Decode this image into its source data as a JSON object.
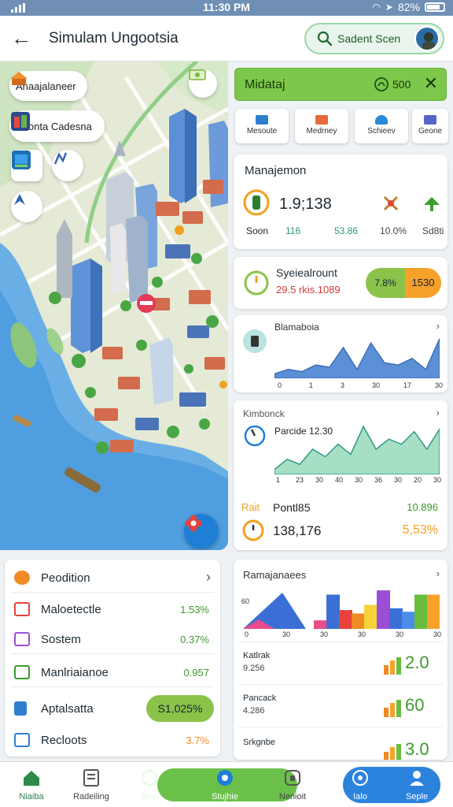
{
  "status": {
    "time": "11:30 PM",
    "battery": "82%"
  },
  "header": {
    "title": "Simulam Ungootsia",
    "search_text": "Sadent Scen"
  },
  "map": {
    "chip_1": "Anaajalaneer",
    "chip_2": "Sbonta Cadesna"
  },
  "panel": {
    "title": "Midataj",
    "coins": "500",
    "quick": [
      "Mesoute",
      "Medrney",
      "Schieev",
      "Geone"
    ]
  },
  "management": {
    "title": "Manajemon",
    "big_value": "1.9;138",
    "labels": [
      "Soon",
      "116",
      "53.86",
      "10.0%",
      "Sd8ti"
    ]
  },
  "scheduler": {
    "title": "Syeiealrount",
    "sub": "29.5 rkis.1089",
    "pill_left": "7.8%",
    "pill_right": "1530"
  },
  "chart1": {
    "title": "Blamaboia",
    "ticks": [
      "0",
      "1",
      "3",
      "30",
      "17",
      "30"
    ]
  },
  "chart2": {
    "title": "Kimbonck",
    "sub": "Parcide 12.30",
    "ticks": [
      "1",
      "23",
      "30",
      "40",
      "30",
      "36",
      "30",
      "20",
      "30"
    ],
    "foot_label": "Rait",
    "foot_name": "Pontl85",
    "foot_right": "10.896",
    "foot_value": "138,176",
    "foot_pct": "5,53%"
  },
  "left_list": {
    "rows": [
      {
        "label": "Peodition",
        "value": ""
      },
      {
        "label": "Maloetectle",
        "value": "1.53%"
      },
      {
        "label": "Sostem",
        "value": "0.37%"
      },
      {
        "label": "Manlriaianoe",
        "value": "0.957"
      },
      {
        "label": "Aptalsatta",
        "value": "S1,025%"
      },
      {
        "label": "Recloots",
        "value": "3.7%"
      }
    ]
  },
  "chart3": {
    "title": "Ramajanaees",
    "ylab": "60",
    "ticks": [
      "0",
      "30",
      "30",
      "30",
      "30",
      "30"
    ],
    "bars": [
      10,
      40,
      22,
      18,
      28,
      45,
      24,
      20,
      40,
      40
    ],
    "bar_colors": [
      "#e84c8b",
      "#3b6fd6",
      "#e8423a",
      "#f08a24",
      "#f6d23a",
      "#9b4fd6",
      "#3b6fd6",
      "#4b8de8",
      "#6abd3f",
      "#f6a12a"
    ]
  },
  "mini_rows": [
    {
      "name": "Katlrak",
      "sub": "9.256",
      "big": "2.0"
    },
    {
      "name": "Pancack",
      "sub": "4.286",
      "big": "60"
    },
    {
      "name": "Srkgnbe",
      "sub": "",
      "big": "3.0"
    }
  ],
  "nav": [
    "Niaiba",
    "Radeiling",
    "Bem",
    "Stujhie",
    "Nenioit",
    "Ialo",
    "Seple"
  ]
}
